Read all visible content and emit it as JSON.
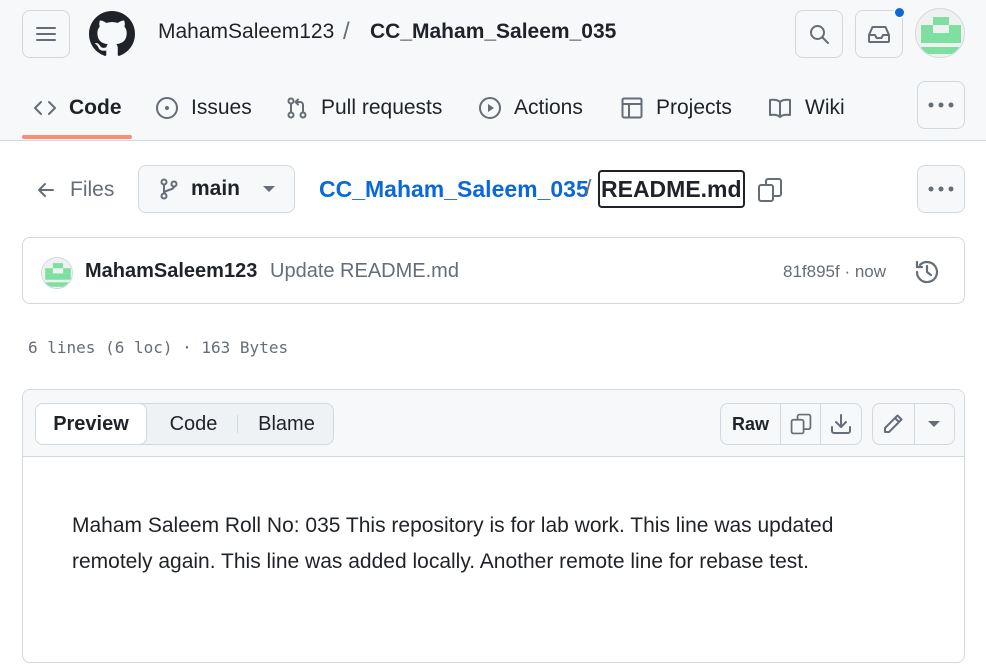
{
  "header": {
    "owner": "MahamSaleem123",
    "separator": "/",
    "repo": "CC_Maham_Saleem_035",
    "notification_color": "#0969da"
  },
  "tabs": [
    {
      "label": "Code",
      "icon": "code-icon",
      "selected": true
    },
    {
      "label": "Issues",
      "icon": "issue-opened-icon"
    },
    {
      "label": "Pull requests",
      "icon": "git-pull-request-icon"
    },
    {
      "label": "Actions",
      "icon": "play-icon"
    },
    {
      "label": "Projects",
      "icon": "table-icon"
    },
    {
      "label": "Wiki",
      "icon": "book-icon"
    }
  ],
  "file_nav": {
    "files_label": "Files",
    "branch": "main",
    "path_repo": "CC_Maham_Saleem_035",
    "path_sep": "/",
    "file_name": "README.md"
  },
  "commit": {
    "author": "MahamSaleem123",
    "message": "Update README.md",
    "meta": "81f895f · now"
  },
  "file_info": "6 lines (6 loc) · 163 Bytes",
  "viewer": {
    "modes": [
      "Preview",
      "Code",
      "Blame"
    ],
    "active_mode": "Preview",
    "raw_label": "Raw"
  },
  "readme_text": "Maham Saleem Roll No: 035 This repository is for lab work. This line was updated remotely again. This line was added locally. Another remote line for rebase test.",
  "colors": {
    "accent_link": "#0969da",
    "tab_underline": "#fd8c73",
    "avatar_green": "#7ee0a0"
  }
}
